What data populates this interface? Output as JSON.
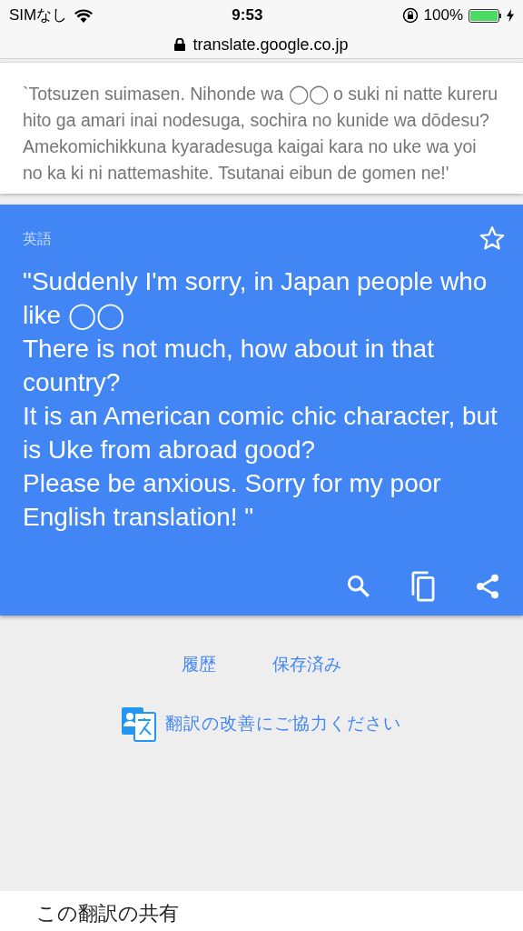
{
  "status_bar": {
    "carrier": "SIMなし",
    "time": "9:53",
    "battery": "100%",
    "charging": true
  },
  "address_bar": {
    "url": "translate.google.co.jp"
  },
  "source": {
    "text": "`Totsuzen suimasen. Nihonde wa ◯◯ o suki ni natte kureru hito ga amari inai nodesuga, sochira no kunide wa dōdesu? Amekomichikkuna kyaradesuga kaigai kara no uke wa yoi no ka ki ni nattemashite. Tsutanai eibun de gomen ne!'"
  },
  "result": {
    "language": "英語",
    "starred": false,
    "text": "\"Suddenly I'm sorry, in Japan people who like ◯◯\nThere is not much, how about in that country?\nIt is an American comic chic character, but is Uke from abroad good?\nPlease be anxious. Sorry for my poor English translation! \""
  },
  "links": [
    "履歴",
    "保存済み"
  ],
  "contribute": {
    "label": "翻訳の改善にご協力ください"
  },
  "share": {
    "title": "この翻訳の共有"
  }
}
